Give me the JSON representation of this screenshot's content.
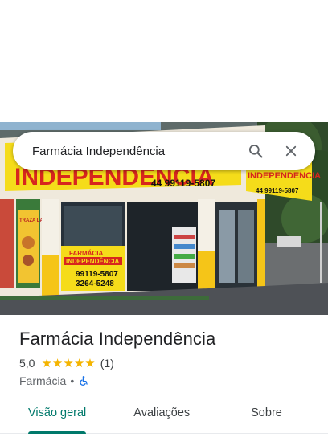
{
  "search": {
    "value": "Farmácia Independência",
    "search_icon": "search-icon",
    "close_icon": "close-icon"
  },
  "photo": {
    "sign_main": "INDEPENDÊNCIA",
    "sign_phone": "44 99119-5807",
    "sign_side": "INDEPENDENCIA",
    "sign_side_phone": "44 99119-5807",
    "window_title_1": "FARMÁCIA",
    "window_title_2": "INDEPENDÊNCIA",
    "window_phone_1": "99119-5807",
    "window_phone_2": "3264-5248",
    "poster_label": "TRAZA LANCHE"
  },
  "place": {
    "title": "Farmácia Independência",
    "rating": "5,0",
    "stars": 5,
    "review_count": "(1)",
    "category": "Farmácia",
    "separator": "•",
    "accessibility_icon": "wheelchair-icon"
  },
  "tabs": [
    {
      "label": "Visão geral",
      "active": true
    },
    {
      "label": "Avaliações",
      "active": false
    },
    {
      "label": "Sobre",
      "active": false
    }
  ],
  "colors": {
    "accent": "#00796b",
    "star": "#f4b400",
    "sign_yellow": "#f5dc1a",
    "sign_red": "#d7261e",
    "accessibility_blue": "#1a73e8"
  }
}
